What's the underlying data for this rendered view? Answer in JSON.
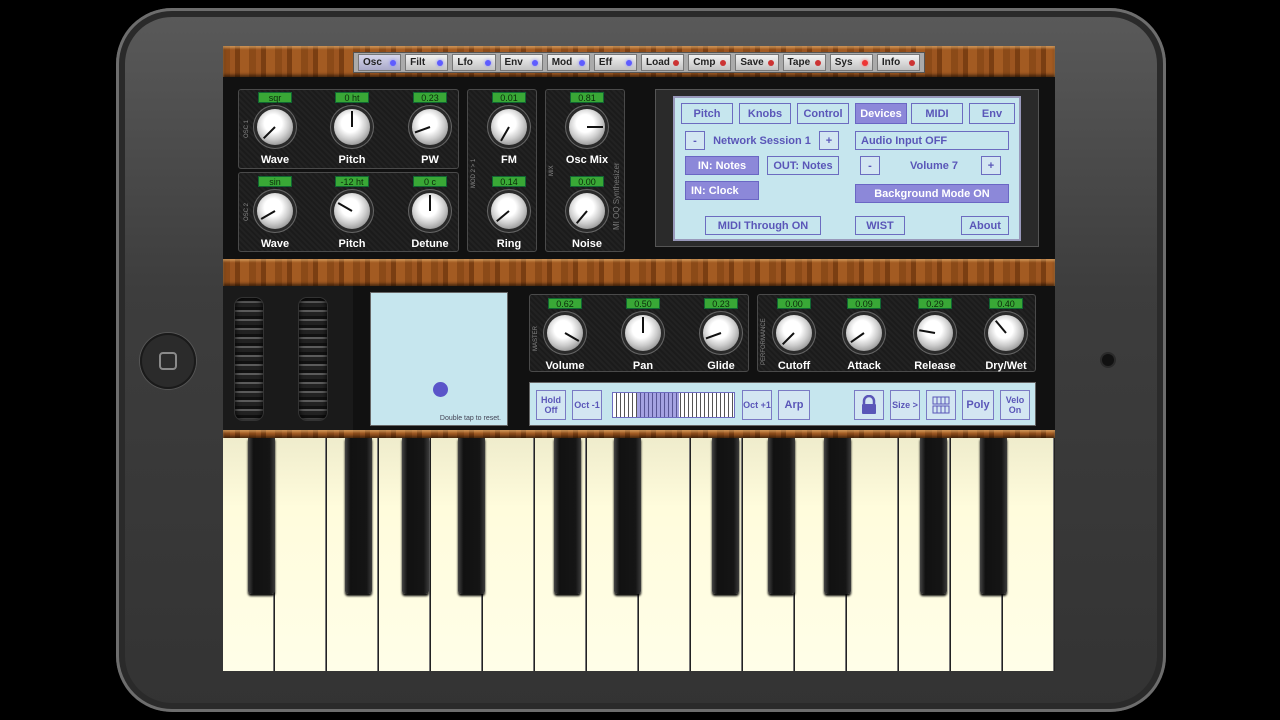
{
  "menu": [
    {
      "label": "Osc",
      "led": "blue",
      "active": true
    },
    {
      "label": "Filt",
      "led": "blue"
    },
    {
      "label": "Lfo",
      "led": "blue"
    },
    {
      "label": "Env",
      "led": "blue"
    },
    {
      "label": "Mod",
      "led": "blue"
    },
    {
      "label": "Eff",
      "led": "blue"
    },
    {
      "label": "Load",
      "led": "dred"
    },
    {
      "label": "Cmp",
      "led": "dred"
    },
    {
      "label": "Save",
      "led": "dred"
    },
    {
      "label": "Tape",
      "led": "dred"
    },
    {
      "label": "Sys",
      "led": "red"
    },
    {
      "label": "Info",
      "led": "dred"
    }
  ],
  "osc1": {
    "label": "OSC 1",
    "wave": {
      "value": "sqr",
      "label": "Wave"
    },
    "pitch": {
      "value": "0 ht",
      "label": "Pitch"
    },
    "pw": {
      "value": "0.23",
      "label": "PW"
    }
  },
  "osc2": {
    "label": "OSC 2",
    "wave": {
      "value": "sin",
      "label": "Wave"
    },
    "pitch": {
      "value": "-12 ht",
      "label": "Pitch"
    },
    "detune": {
      "value": "0 c",
      "label": "Detune"
    }
  },
  "mod": {
    "label": "MOD 2 > 1",
    "fm": {
      "value": "0.01",
      "label": "FM"
    },
    "ring": {
      "value": "0.14",
      "label": "Ring"
    }
  },
  "mix": {
    "label": "MIX",
    "osc_mix": {
      "value": "0.81",
      "label": "Osc Mix"
    },
    "noise": {
      "value": "0.00",
      "label": "Noise"
    },
    "brand": "MI OQ Synthesizer"
  },
  "lcd": {
    "tabs": [
      {
        "label": "Pitch",
        "active": false
      },
      {
        "label": "Knobs",
        "active": false
      },
      {
        "label": "Control",
        "active": false
      },
      {
        "label": "Devices",
        "active": true
      },
      {
        "label": "MIDI",
        "active": false
      },
      {
        "label": "Env",
        "active": false
      }
    ],
    "minus": "-",
    "plus": "+",
    "network_session": "Network Session 1",
    "audio_input": "Audio Input OFF",
    "in_notes": "IN: Notes",
    "out_notes": "OUT: Notes",
    "volume": "Volume 7",
    "in_clock": "IN: Clock",
    "background_mode": "Background Mode ON",
    "midi_through": "MIDI Through ON",
    "wist": "WIST",
    "about": "About"
  },
  "xy_pad": {
    "hint": "Double tap to reset."
  },
  "master": {
    "label": "MASTER",
    "volume": {
      "value": "0.62",
      "label": "Volume"
    },
    "pan": {
      "value": "0.50",
      "label": "Pan"
    },
    "glide": {
      "value": "0.23",
      "label": "Glide"
    }
  },
  "performance": {
    "label": "PERFORMANCE",
    "cutoff": {
      "value": "0.00",
      "label": "Cutoff"
    },
    "attack": {
      "value": "0.09",
      "label": "Attack"
    },
    "release": {
      "value": "0.29",
      "label": "Release"
    },
    "drywet": {
      "value": "0.40",
      "label": "Dry/Wet"
    }
  },
  "controls": {
    "hold": "Hold Off",
    "oct_down": "Oct -1",
    "oct_up": "Oct +1",
    "arp": "Arp",
    "size": "Size >",
    "poly": "Poly",
    "velo": "Velo On"
  }
}
